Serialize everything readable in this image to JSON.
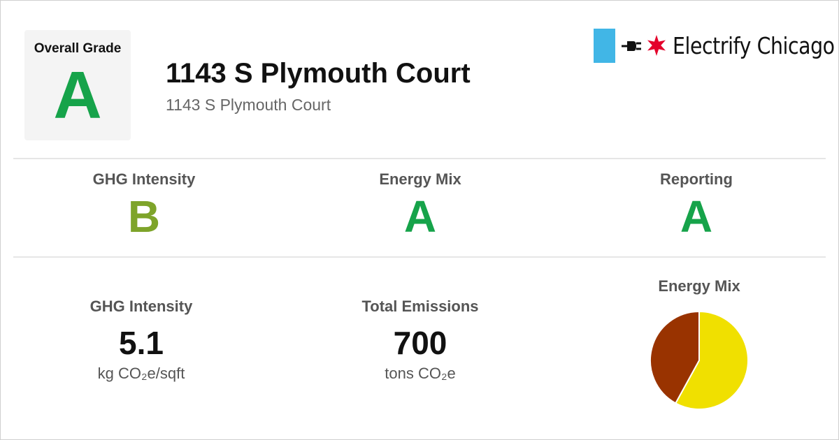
{
  "overall": {
    "label": "Overall Grade",
    "grade": "A",
    "grade_color": "#16a34a"
  },
  "building": {
    "name": "1143 S Plymouth Court",
    "address": "1143 S Plymouth Court"
  },
  "logo": {
    "brand": "Electrify Chicago",
    "flag_color": "#41b6e6",
    "star_color": "#e4002b",
    "icons": [
      "plug-icon",
      "chicago-star-icon"
    ]
  },
  "grades": [
    {
      "label": "GHG Intensity",
      "grade": "B",
      "color": "#7ea42a"
    },
    {
      "label": "Energy Mix",
      "grade": "A",
      "color": "#16a34a"
    },
    {
      "label": "Reporting",
      "grade": "A",
      "color": "#16a34a"
    }
  ],
  "stats": {
    "ghg_intensity": {
      "label": "GHG Intensity",
      "value": "5.1",
      "unit": "kg CO₂e/sqft"
    },
    "total_emissions": {
      "label": "Total Emissions",
      "value": "700",
      "unit": "tons CO₂e"
    }
  },
  "energy_mix": {
    "title": "Energy Mix"
  },
  "chart_data": {
    "type": "pie",
    "title": "Energy Mix",
    "categories": [
      "",
      ""
    ],
    "values": [
      58,
      42
    ],
    "colors": [
      "#f0e000",
      "#993300"
    ]
  }
}
